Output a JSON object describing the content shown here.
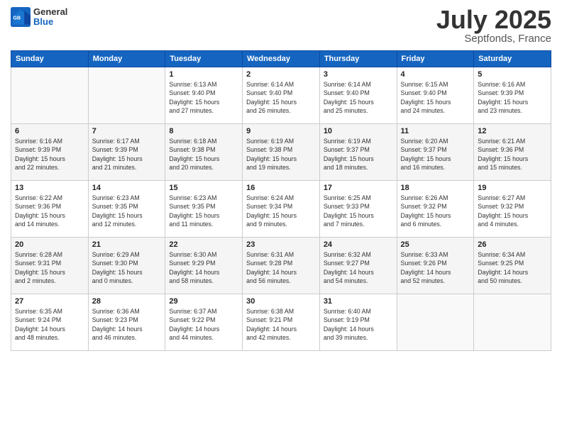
{
  "header": {
    "logo_general": "General",
    "logo_blue": "Blue",
    "title": "July 2025",
    "location": "Septfonds, France"
  },
  "days_of_week": [
    "Sunday",
    "Monday",
    "Tuesday",
    "Wednesday",
    "Thursday",
    "Friday",
    "Saturday"
  ],
  "weeks": [
    [
      {
        "day": "",
        "info": ""
      },
      {
        "day": "",
        "info": ""
      },
      {
        "day": "1",
        "info": "Sunrise: 6:13 AM\nSunset: 9:40 PM\nDaylight: 15 hours\nand 27 minutes."
      },
      {
        "day": "2",
        "info": "Sunrise: 6:14 AM\nSunset: 9:40 PM\nDaylight: 15 hours\nand 26 minutes."
      },
      {
        "day": "3",
        "info": "Sunrise: 6:14 AM\nSunset: 9:40 PM\nDaylight: 15 hours\nand 25 minutes."
      },
      {
        "day": "4",
        "info": "Sunrise: 6:15 AM\nSunset: 9:40 PM\nDaylight: 15 hours\nand 24 minutes."
      },
      {
        "day": "5",
        "info": "Sunrise: 6:16 AM\nSunset: 9:39 PM\nDaylight: 15 hours\nand 23 minutes."
      }
    ],
    [
      {
        "day": "6",
        "info": "Sunrise: 6:16 AM\nSunset: 9:39 PM\nDaylight: 15 hours\nand 22 minutes."
      },
      {
        "day": "7",
        "info": "Sunrise: 6:17 AM\nSunset: 9:39 PM\nDaylight: 15 hours\nand 21 minutes."
      },
      {
        "day": "8",
        "info": "Sunrise: 6:18 AM\nSunset: 9:38 PM\nDaylight: 15 hours\nand 20 minutes."
      },
      {
        "day": "9",
        "info": "Sunrise: 6:19 AM\nSunset: 9:38 PM\nDaylight: 15 hours\nand 19 minutes."
      },
      {
        "day": "10",
        "info": "Sunrise: 6:19 AM\nSunset: 9:37 PM\nDaylight: 15 hours\nand 18 minutes."
      },
      {
        "day": "11",
        "info": "Sunrise: 6:20 AM\nSunset: 9:37 PM\nDaylight: 15 hours\nand 16 minutes."
      },
      {
        "day": "12",
        "info": "Sunrise: 6:21 AM\nSunset: 9:36 PM\nDaylight: 15 hours\nand 15 minutes."
      }
    ],
    [
      {
        "day": "13",
        "info": "Sunrise: 6:22 AM\nSunset: 9:36 PM\nDaylight: 15 hours\nand 14 minutes."
      },
      {
        "day": "14",
        "info": "Sunrise: 6:23 AM\nSunset: 9:35 PM\nDaylight: 15 hours\nand 12 minutes."
      },
      {
        "day": "15",
        "info": "Sunrise: 6:23 AM\nSunset: 9:35 PM\nDaylight: 15 hours\nand 11 minutes."
      },
      {
        "day": "16",
        "info": "Sunrise: 6:24 AM\nSunset: 9:34 PM\nDaylight: 15 hours\nand 9 minutes."
      },
      {
        "day": "17",
        "info": "Sunrise: 6:25 AM\nSunset: 9:33 PM\nDaylight: 15 hours\nand 7 minutes."
      },
      {
        "day": "18",
        "info": "Sunrise: 6:26 AM\nSunset: 9:32 PM\nDaylight: 15 hours\nand 6 minutes."
      },
      {
        "day": "19",
        "info": "Sunrise: 6:27 AM\nSunset: 9:32 PM\nDaylight: 15 hours\nand 4 minutes."
      }
    ],
    [
      {
        "day": "20",
        "info": "Sunrise: 6:28 AM\nSunset: 9:31 PM\nDaylight: 15 hours\nand 2 minutes."
      },
      {
        "day": "21",
        "info": "Sunrise: 6:29 AM\nSunset: 9:30 PM\nDaylight: 15 hours\nand 0 minutes."
      },
      {
        "day": "22",
        "info": "Sunrise: 6:30 AM\nSunset: 9:29 PM\nDaylight: 14 hours\nand 58 minutes."
      },
      {
        "day": "23",
        "info": "Sunrise: 6:31 AM\nSunset: 9:28 PM\nDaylight: 14 hours\nand 56 minutes."
      },
      {
        "day": "24",
        "info": "Sunrise: 6:32 AM\nSunset: 9:27 PM\nDaylight: 14 hours\nand 54 minutes."
      },
      {
        "day": "25",
        "info": "Sunrise: 6:33 AM\nSunset: 9:26 PM\nDaylight: 14 hours\nand 52 minutes."
      },
      {
        "day": "26",
        "info": "Sunrise: 6:34 AM\nSunset: 9:25 PM\nDaylight: 14 hours\nand 50 minutes."
      }
    ],
    [
      {
        "day": "27",
        "info": "Sunrise: 6:35 AM\nSunset: 9:24 PM\nDaylight: 14 hours\nand 48 minutes."
      },
      {
        "day": "28",
        "info": "Sunrise: 6:36 AM\nSunset: 9:23 PM\nDaylight: 14 hours\nand 46 minutes."
      },
      {
        "day": "29",
        "info": "Sunrise: 6:37 AM\nSunset: 9:22 PM\nDaylight: 14 hours\nand 44 minutes."
      },
      {
        "day": "30",
        "info": "Sunrise: 6:38 AM\nSunset: 9:21 PM\nDaylight: 14 hours\nand 42 minutes."
      },
      {
        "day": "31",
        "info": "Sunrise: 6:40 AM\nSunset: 9:19 PM\nDaylight: 14 hours\nand 39 minutes."
      },
      {
        "day": "",
        "info": ""
      },
      {
        "day": "",
        "info": ""
      }
    ]
  ]
}
